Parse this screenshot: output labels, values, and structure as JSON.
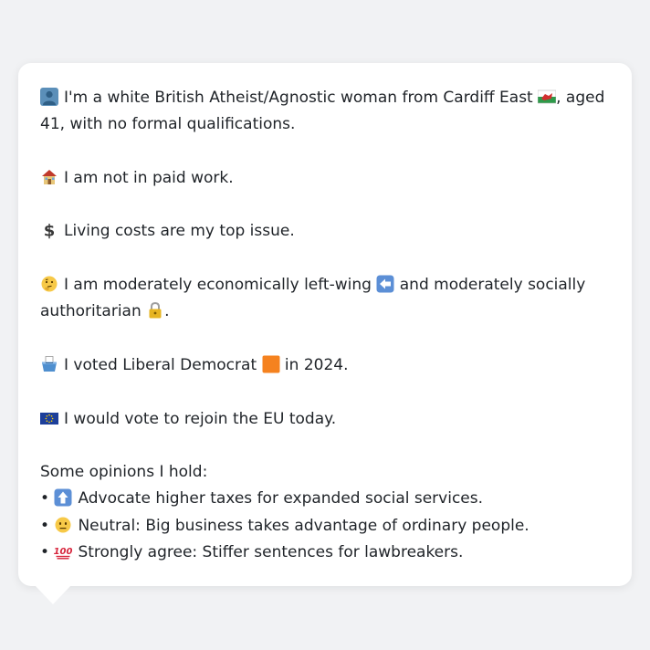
{
  "profile": {
    "identity": {
      "icon": "person-silhouette-icon",
      "text_before_flag": "I'm a white British Atheist/Agnostic woman from Cardiff East",
      "flag_icon": "wales-flag-icon",
      "text_after_flag": ", aged 41, with no formal qualifications."
    },
    "work": {
      "icon": "house-icon",
      "text": "I am not in paid work."
    },
    "issue": {
      "icon": "dollar-sign-icon",
      "text": "Living costs are my top issue."
    },
    "politics": {
      "icon": "thinking-face-icon",
      "text_a": "I am moderately economically left-wing",
      "left_arrow_icon": "left-arrow-icon",
      "text_b": "and moderately socially authoritarian",
      "lock_icon": "lock-icon",
      "text_c": "."
    },
    "vote": {
      "icon": "ballot-box-icon",
      "text_a": "I voted Liberal Democrat",
      "party_icon": "orange-square-icon",
      "text_b": "in 2024."
    },
    "eu": {
      "icon": "eu-flag-icon",
      "text": "I would vote to rejoin the EU today."
    },
    "opinions": {
      "heading": "Some opinions I hold:",
      "bullet": "•",
      "items": [
        {
          "icon": "up-arrow-icon",
          "text": "Advocate higher taxes for expanded social services."
        },
        {
          "icon": "neutral-face-icon",
          "text": "Neutral: Big business takes advantage of ordinary people."
        },
        {
          "icon": "hundred-points-icon",
          "text": "Strongly agree: Stiffer sentences for lawbreakers."
        }
      ]
    }
  },
  "colors": {
    "background": "#f1f2f4",
    "card": "#ffffff",
    "text": "#1f2328"
  }
}
